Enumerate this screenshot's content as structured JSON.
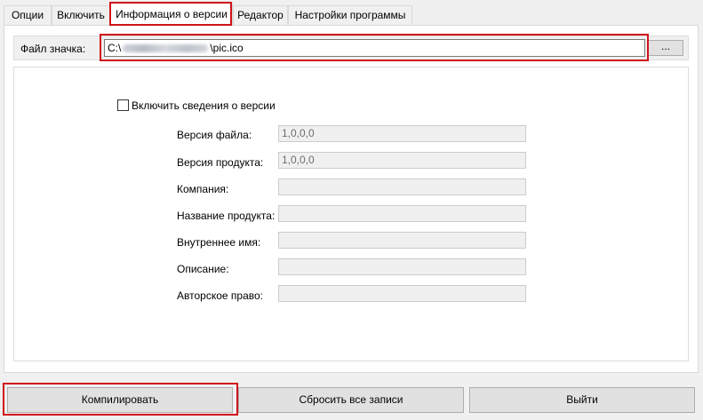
{
  "tabs": [
    {
      "label": "Опции"
    },
    {
      "label": "Включить"
    },
    {
      "label": "Информация о версии"
    },
    {
      "label": "Редактор"
    },
    {
      "label": "Настройки программы"
    }
  ],
  "icon_file": {
    "label": "Файл значка:",
    "path_prefix": "C:\\",
    "path_suffix": "\\pic.ico",
    "browse_label": "..."
  },
  "version": {
    "checkbox_label": "Включить сведения о версии",
    "fields": [
      {
        "label": "Версия файла:",
        "value": "1,0,0,0"
      },
      {
        "label": "Версия продукта:",
        "value": "1,0,0,0"
      },
      {
        "label": "Компания:",
        "value": ""
      },
      {
        "label": "Название продукта:",
        "value": ""
      },
      {
        "label": "Внутреннее имя:",
        "value": ""
      },
      {
        "label": "Описание:",
        "value": ""
      },
      {
        "label": "Авторское право:",
        "value": ""
      }
    ]
  },
  "buttons": {
    "compile": "Компилировать",
    "reset": "Сбросить все записи",
    "exit": "Выйти"
  },
  "colors": {
    "highlight": "#d0131a",
    "background": "#f0f0f0"
  }
}
